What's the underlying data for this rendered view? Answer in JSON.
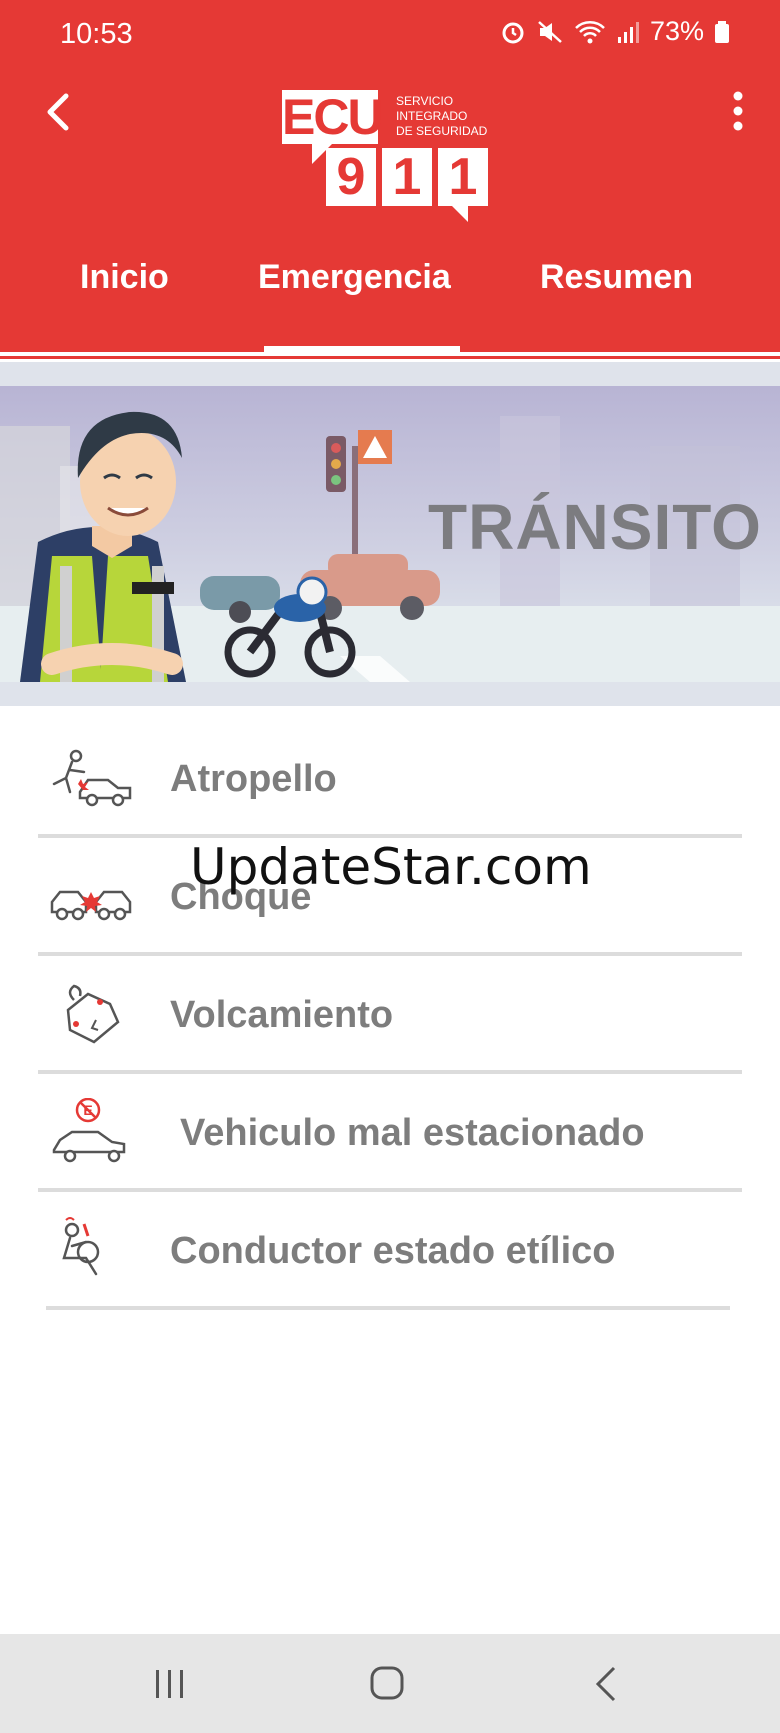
{
  "status_bar": {
    "time": "10:53",
    "battery": "73%"
  },
  "header": {
    "logo": {
      "ecu": "ECU",
      "digits": [
        "9",
        "1",
        "1"
      ],
      "tagline_lines": [
        "SERVICIO",
        "INTEGRADO",
        "DE SEGURIDAD"
      ]
    },
    "tabs": [
      {
        "label": "Inicio",
        "active": false
      },
      {
        "label": "Emergencia",
        "active": true
      },
      {
        "label": "Resumen",
        "active": false
      }
    ],
    "back_icon": "back-arrow-icon",
    "menu_icon": "more-vertical-icon",
    "brand_color": "#e53935"
  },
  "banner": {
    "title": "TRÁNSITO"
  },
  "emergency_items": [
    {
      "label": "Atropello",
      "icon": "pedestrian-hit-icon"
    },
    {
      "label": "Choque",
      "icon": "car-crash-icon"
    },
    {
      "label": "Volcamiento",
      "icon": "rollover-icon"
    },
    {
      "label": "Vehiculo mal estacionado",
      "icon": "no-parking-car-icon"
    },
    {
      "label": "Conductor estado etílico",
      "icon": "drunk-driver-icon"
    }
  ],
  "watermark": "UpdateStar.com",
  "nav_bar": {
    "buttons": [
      "recent-apps-icon",
      "home-icon",
      "back-icon"
    ]
  }
}
